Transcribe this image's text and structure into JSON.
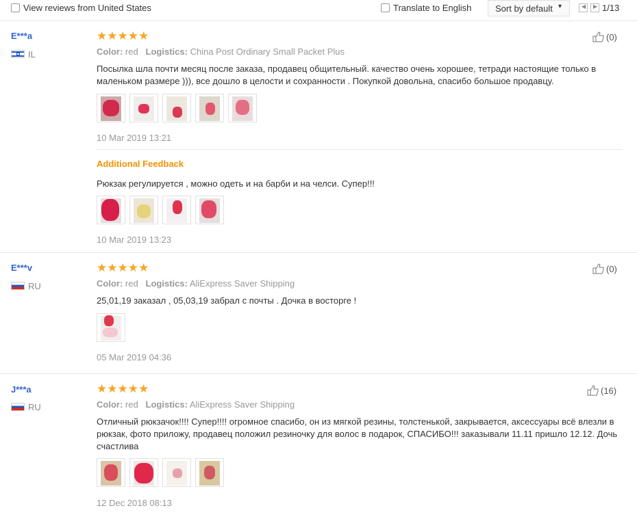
{
  "toolbar": {
    "view_reviews_label": "View reviews from United States",
    "translate_label": "Translate to English",
    "sort_label": "Sort by default",
    "page_indicator": "1/13"
  },
  "colors": {
    "accent_orange": "#f29300",
    "star": "#f5a623",
    "username_blue": "#3366cc"
  },
  "reviews": [
    {
      "user": "E***a",
      "country": "IL",
      "stars": "★★★★★",
      "likes": "(0)",
      "color_key": "Color:",
      "color_value": "red",
      "logistics_key": "Logistics:",
      "logistics_value": "China Post Ordinary Small Packet Plus",
      "text": "Посылка шла почти месяц после заказа, продавец общительный. качество очень хорошее, тетради настоящие только в маленьком размере ))), все дошло в целости и сохранности . Покупкой довольна, спасибо большое продавцу.",
      "date": "10 Mar 2019 13:21",
      "additional_feedback": {
        "label": "Additional Feedback",
        "text": "Рюкзак регулируется , можно одеть и на барби и на челси. Супер!!!",
        "date": "10 Mar 2019 13:23"
      }
    },
    {
      "user": "E***v",
      "country": "RU",
      "stars": "★★★★★",
      "likes": "(0)",
      "color_key": "Color:",
      "color_value": "red",
      "logistics_key": "Logistics:",
      "logistics_value": "AliExpress Saver Shipping",
      "text": "25,01,19 заказал , 05,03,19 забрал с почты . Дочка в восторге !",
      "date": "05 Mar 2019 04:36"
    },
    {
      "user": "J***a",
      "country": "RU",
      "stars": "★★★★★",
      "likes": "(16)",
      "color_key": "Color:",
      "color_value": "red",
      "logistics_key": "Logistics:",
      "logistics_value": "AliExpress Saver Shipping",
      "text": "Отличный рюкзачок!!!! Супер!!!! огромное спасибо, он из мягкой резины, толстенькой, закрывается, аксессуары всё влезли в рюкзак, фото приложу, продавец положил резиночку для волос в подарок, СПАСИБО!!! заказывали 11.11 пришло 12.12. Дочь счастлива",
      "date": "12 Dec 2018 08:13"
    }
  ]
}
